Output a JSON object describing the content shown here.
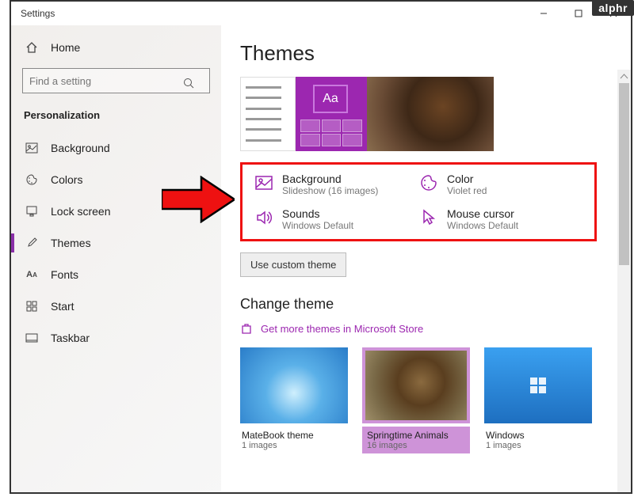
{
  "watermark": "alphr",
  "window": {
    "title": "Settings"
  },
  "sidebar": {
    "home": "Home",
    "search_placeholder": "Find a setting",
    "category": "Personalization",
    "items": [
      {
        "label": "Background",
        "icon": "picture-icon"
      },
      {
        "label": "Colors",
        "icon": "palette-icon"
      },
      {
        "label": "Lock screen",
        "icon": "lock-screen-icon"
      },
      {
        "label": "Themes",
        "icon": "brush-icon",
        "active": true
      },
      {
        "label": "Fonts",
        "icon": "font-icon"
      },
      {
        "label": "Start",
        "icon": "start-icon"
      },
      {
        "label": "Taskbar",
        "icon": "taskbar-icon"
      }
    ]
  },
  "page": {
    "title": "Themes",
    "preview_aa": "Aa",
    "settings": {
      "background": {
        "label": "Background",
        "sub": "Slideshow (16 images)"
      },
      "color": {
        "label": "Color",
        "sub": "Violet red"
      },
      "sounds": {
        "label": "Sounds",
        "sub": "Windows Default"
      },
      "cursor": {
        "label": "Mouse cursor",
        "sub": "Windows Default"
      }
    },
    "custom_btn": "Use custom theme",
    "change_title": "Change theme",
    "store_link": "Get more themes in Microsoft Store",
    "themes": [
      {
        "name": "MateBook theme",
        "count": "1 images"
      },
      {
        "name": "Springtime Animals",
        "count": "16 images",
        "selected": true
      },
      {
        "name": "Windows",
        "count": "1 images"
      }
    ]
  }
}
